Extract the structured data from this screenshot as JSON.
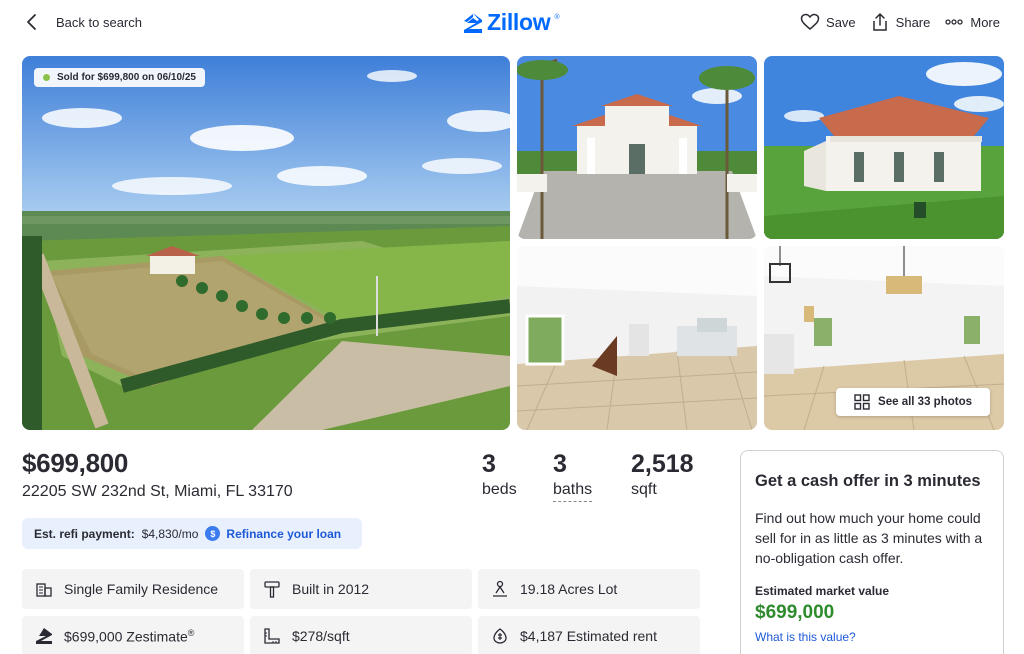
{
  "header": {
    "back_label": "Back to search",
    "logo_text": "Zillow",
    "logo_reg": "®",
    "save_label": "Save",
    "share_label": "Share",
    "more_label": "More",
    "brand_color": "#006aff"
  },
  "gallery": {
    "sold_badge": "Sold for $699,800 on 06/10/25",
    "see_all_label": "See all 33 photos",
    "photo_count": 33
  },
  "summary": {
    "price": "$699,800",
    "address": "22205 SW 232nd St, Miami, FL 33170",
    "beds_value": "3",
    "beds_label": "beds",
    "baths_value": "3",
    "baths_label": "baths",
    "sqft_value": "2,518",
    "sqft_label": "sqft"
  },
  "refi": {
    "label": "Est. refi payment:",
    "value": "$4,830/mo",
    "link": "Refinance your loan"
  },
  "facts": [
    {
      "text": "Single Family Residence",
      "icon": "house-icon"
    },
    {
      "text": "Built in 2012",
      "icon": "hammer-icon"
    },
    {
      "text": "19.18 Acres Lot",
      "icon": "lot-icon"
    },
    {
      "text": "$699,000 Zestimate",
      "sup": "®",
      "icon": "zestimate-icon"
    },
    {
      "text": "$278/sqft",
      "icon": "ruler-icon"
    },
    {
      "text": "$4,187 Estimated rent",
      "icon": "rent-icon"
    }
  ],
  "cash_offer": {
    "title": "Get a cash offer in 3 minutes",
    "body": "Find out how much your home could sell for in as little as 3 minutes with a no-obligation cash offer.",
    "value_label": "Estimated market value",
    "value": "$699,000",
    "link": "What is this value?",
    "value_color": "#2e8b2e"
  }
}
